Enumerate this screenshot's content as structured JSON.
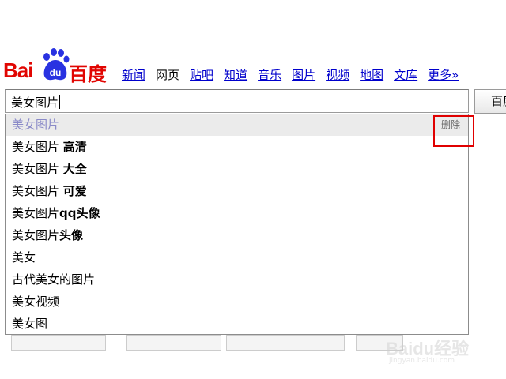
{
  "logo": {
    "text_latin": "Bai",
    "text_du": "du",
    "text_cn": "百度"
  },
  "nav": {
    "items": [
      {
        "label": "新闻",
        "current": false
      },
      {
        "label": "网页",
        "current": true
      },
      {
        "label": "贴吧",
        "current": false
      },
      {
        "label": "知道",
        "current": false
      },
      {
        "label": "音乐",
        "current": false
      },
      {
        "label": "图片",
        "current": false
      },
      {
        "label": "视频",
        "current": false
      },
      {
        "label": "地图",
        "current": false
      },
      {
        "label": "文库",
        "current": false
      },
      {
        "label": "更多»",
        "current": false
      }
    ]
  },
  "search": {
    "value": "美女图片",
    "button_label": "百度"
  },
  "suggestions": {
    "delete_label": "删除",
    "items": [
      {
        "base": "美女图片",
        "suffix": ""
      },
      {
        "base": "美女图片 ",
        "suffix": "高清"
      },
      {
        "base": "美女图片 ",
        "suffix": "大全"
      },
      {
        "base": "美女图片 ",
        "suffix": "可爱"
      },
      {
        "base": "美女图片",
        "suffix": "qq头像"
      },
      {
        "base": "美女图片",
        "suffix": "头像"
      },
      {
        "base": "美女",
        "suffix": ""
      },
      {
        "base": "古代美女的图片",
        "suffix": ""
      },
      {
        "base": "美女视频",
        "suffix": ""
      },
      {
        "base": "美女图",
        "suffix": ""
      }
    ]
  },
  "watermark": {
    "text": "Baidu经验",
    "sub": "jingyan.baidu.com"
  },
  "colors": {
    "brand_red": "#e10602",
    "link_blue": "#0000cc",
    "highlight_bg": "#ebebeb",
    "annotation_red": "#e00000"
  }
}
